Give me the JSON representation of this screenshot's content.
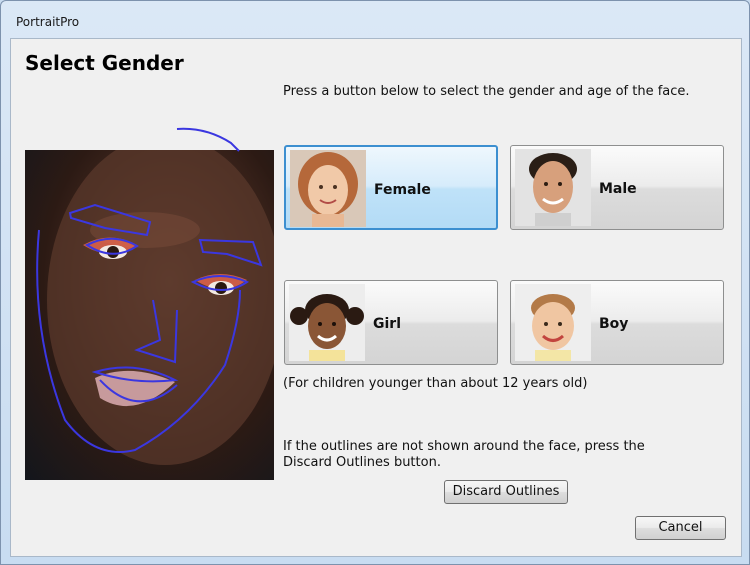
{
  "window": {
    "title": "PortraitPro"
  },
  "dialog": {
    "heading": "Select Gender",
    "instructions": "Press a button below to select the gender and age of the face.",
    "gender_buttons": [
      {
        "label": "Female",
        "selected": true,
        "thumb": "woman-portrait"
      },
      {
        "label": "Male",
        "selected": false,
        "thumb": "man-portrait"
      },
      {
        "label": "Girl",
        "selected": false,
        "thumb": "girl-portrait"
      },
      {
        "label": "Boy",
        "selected": false,
        "thumb": "boy-portrait"
      }
    ],
    "children_note": "(For children younger than about 12 years old)",
    "outline_note_line1": "If the outlines are not shown around the face, press the",
    "outline_note_line2": "Discard Outlines button.",
    "discard_label": "Discard Outlines",
    "cancel_label": "Cancel"
  },
  "colors": {
    "outline": "#3b37e0",
    "selected_border": "#3c8fd0"
  }
}
